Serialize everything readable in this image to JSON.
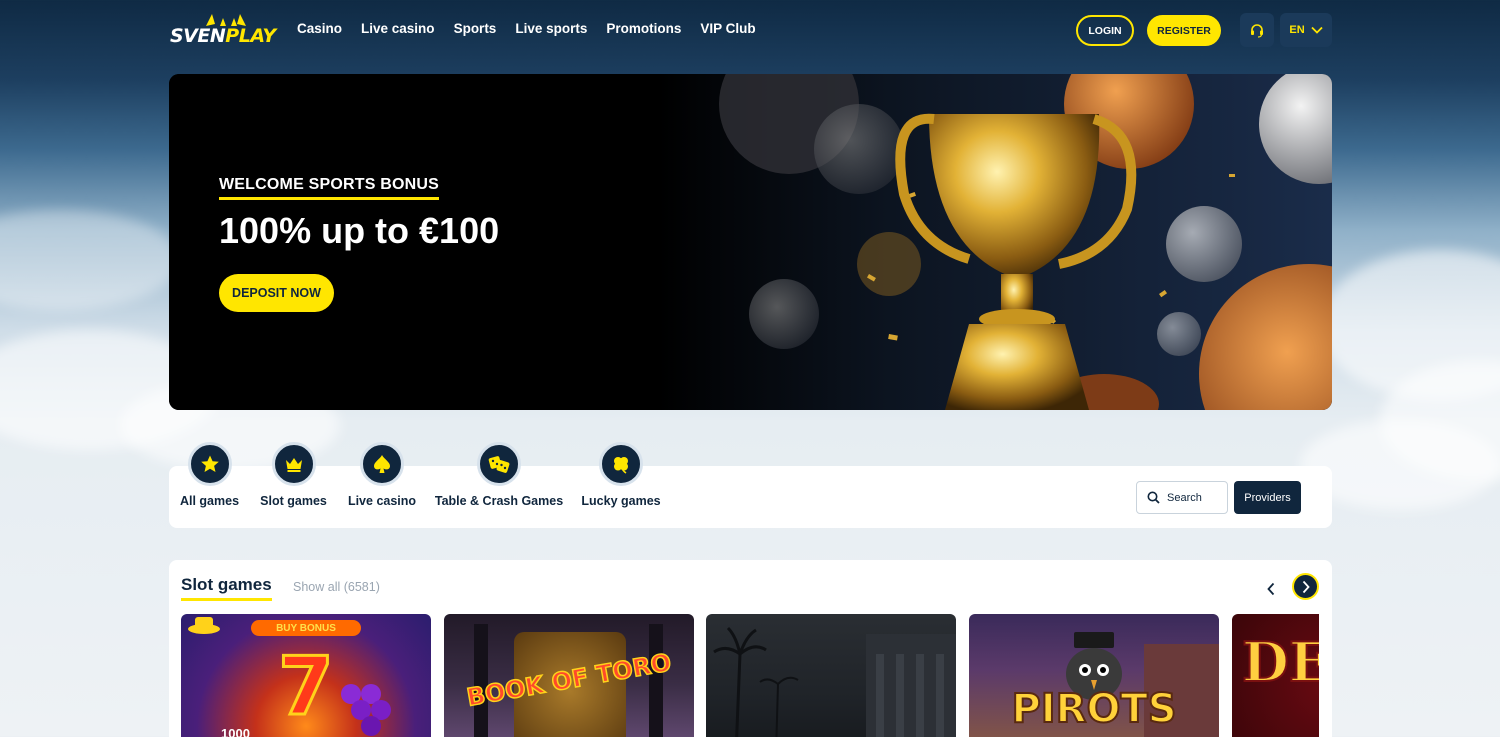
{
  "brand": {
    "logo_part1": "SVEN",
    "logo_part2": "PLAY",
    "accent": "#ffe600",
    "navy": "#10263d"
  },
  "nav": {
    "items": [
      {
        "label": "Casino"
      },
      {
        "label": "Live casino"
      },
      {
        "label": "Sports"
      },
      {
        "label": "Live sports"
      },
      {
        "label": "Promotions"
      },
      {
        "label": "VIP Club"
      }
    ]
  },
  "header": {
    "login": "LOGIN",
    "register": "REGISTER",
    "support_icon": "headset-icon",
    "language": "EN"
  },
  "hero": {
    "subtitle": "WELCOME SPORTS BONUS",
    "title": "100% up to €100",
    "cta": "DEPOSIT NOW"
  },
  "categories": [
    {
      "label": "All games",
      "icon": "star-icon"
    },
    {
      "label": "Slot games",
      "icon": "crown-icon"
    },
    {
      "label": "Live casino",
      "icon": "spade-icon"
    },
    {
      "label": "Table & Crash Games",
      "icon": "dice-icon"
    },
    {
      "label": "Lucky games",
      "icon": "clover-icon"
    }
  ],
  "search": {
    "label": "Search"
  },
  "providers": {
    "label": "Providers"
  },
  "slot_games": {
    "title": "Slot games",
    "show_all": "Show all (6581)",
    "tiles": [
      {
        "name": "7",
        "banner": "BUY BONUS",
        "badge": "1000"
      },
      {
        "name": "BOOK OF TORO"
      },
      {
        "name": ""
      },
      {
        "name": "PIROTS"
      },
      {
        "name": "DE"
      }
    ]
  }
}
